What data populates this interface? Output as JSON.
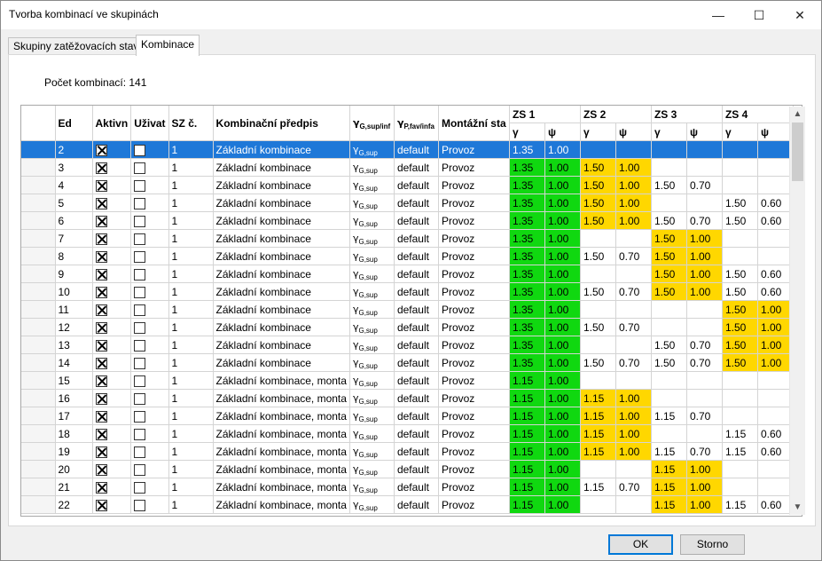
{
  "window": {
    "title": "Tvorba kombinací ve skupinách"
  },
  "titlebar_icons": {
    "minimize": "minimize-icon",
    "maximize": "maximize-icon",
    "close": "close-icon"
  },
  "tabs": [
    {
      "label": "Skupiny zatěžovacích stavů",
      "active": false
    },
    {
      "label": "Kombinace",
      "active": true
    }
  ],
  "count_label": "Počet kombinací: 141",
  "columns": {
    "ed": "Ed",
    "active": "Aktivn",
    "user": "Uživat",
    "sz": "SZ č.",
    "rule": "Kombinační předpis",
    "gamma_g_sym": "γ",
    "gamma_g_sub": "G,sup/inf",
    "gamma_p_sym": "γ",
    "gamma_p_sub": "P,fav/infa",
    "mont": "Montážní sta",
    "groups": [
      "ZS 1",
      "ZS 2",
      "ZS 3",
      "ZS 4"
    ],
    "gamma": "γ",
    "psi": "ψ"
  },
  "colors": {
    "green": "#10d810",
    "yellow": "#ffd700",
    "selected": "#1e78d8"
  },
  "rows": [
    {
      "ed": "2",
      "active": true,
      "user": false,
      "sz": "1",
      "rule": "Základní kombinace",
      "gsub": "G,sup",
      "p": "default",
      "mont": "Provoz",
      "v": [
        [
          "1.35",
          "1.00",
          "g"
        ],
        [
          "",
          "",
          ""
        ],
        [
          "",
          "",
          ""
        ],
        [
          "",
          "",
          ""
        ]
      ],
      "selected": true
    },
    {
      "ed": "3",
      "active": true,
      "user": false,
      "sz": "1",
      "rule": "Základní kombinace",
      "gsub": "G,sup",
      "p": "default",
      "mont": "Provoz",
      "v": [
        [
          "1.35",
          "1.00",
          "g"
        ],
        [
          "1.50",
          "1.00",
          "y"
        ],
        [
          "",
          "",
          ""
        ],
        [
          "",
          "",
          ""
        ]
      ]
    },
    {
      "ed": "4",
      "active": true,
      "user": false,
      "sz": "1",
      "rule": "Základní kombinace",
      "gsub": "G,sup",
      "p": "default",
      "mont": "Provoz",
      "v": [
        [
          "1.35",
          "1.00",
          "g"
        ],
        [
          "1.50",
          "1.00",
          "y"
        ],
        [
          "1.50",
          "0.70",
          ""
        ],
        [
          "",
          "",
          ""
        ]
      ]
    },
    {
      "ed": "5",
      "active": true,
      "user": false,
      "sz": "1",
      "rule": "Základní kombinace",
      "gsub": "G,sup",
      "p": "default",
      "mont": "Provoz",
      "v": [
        [
          "1.35",
          "1.00",
          "g"
        ],
        [
          "1.50",
          "1.00",
          "y"
        ],
        [
          "",
          "",
          ""
        ],
        [
          "1.50",
          "0.60",
          ""
        ]
      ]
    },
    {
      "ed": "6",
      "active": true,
      "user": false,
      "sz": "1",
      "rule": "Základní kombinace",
      "gsub": "G,sup",
      "p": "default",
      "mont": "Provoz",
      "v": [
        [
          "1.35",
          "1.00",
          "g"
        ],
        [
          "1.50",
          "1.00",
          "y"
        ],
        [
          "1.50",
          "0.70",
          ""
        ],
        [
          "1.50",
          "0.60",
          ""
        ]
      ]
    },
    {
      "ed": "7",
      "active": true,
      "user": false,
      "sz": "1",
      "rule": "Základní kombinace",
      "gsub": "G,sup",
      "p": "default",
      "mont": "Provoz",
      "v": [
        [
          "1.35",
          "1.00",
          "g"
        ],
        [
          "",
          "",
          ""
        ],
        [
          "1.50",
          "1.00",
          "y"
        ],
        [
          "",
          "",
          ""
        ]
      ]
    },
    {
      "ed": "8",
      "active": true,
      "user": false,
      "sz": "1",
      "rule": "Základní kombinace",
      "gsub": "G,sup",
      "p": "default",
      "mont": "Provoz",
      "v": [
        [
          "1.35",
          "1.00",
          "g"
        ],
        [
          "1.50",
          "0.70",
          ""
        ],
        [
          "1.50",
          "1.00",
          "y"
        ],
        [
          "",
          "",
          ""
        ]
      ]
    },
    {
      "ed": "9",
      "active": true,
      "user": false,
      "sz": "1",
      "rule": "Základní kombinace",
      "gsub": "G,sup",
      "p": "default",
      "mont": "Provoz",
      "v": [
        [
          "1.35",
          "1.00",
          "g"
        ],
        [
          "",
          "",
          ""
        ],
        [
          "1.50",
          "1.00",
          "y"
        ],
        [
          "1.50",
          "0.60",
          ""
        ]
      ]
    },
    {
      "ed": "10",
      "active": true,
      "user": false,
      "sz": "1",
      "rule": "Základní kombinace",
      "gsub": "G,sup",
      "p": "default",
      "mont": "Provoz",
      "v": [
        [
          "1.35",
          "1.00",
          "g"
        ],
        [
          "1.50",
          "0.70",
          ""
        ],
        [
          "1.50",
          "1.00",
          "y"
        ],
        [
          "1.50",
          "0.60",
          ""
        ]
      ]
    },
    {
      "ed": "11",
      "active": true,
      "user": false,
      "sz": "1",
      "rule": "Základní kombinace",
      "gsub": "G,sup",
      "p": "default",
      "mont": "Provoz",
      "v": [
        [
          "1.35",
          "1.00",
          "g"
        ],
        [
          "",
          "",
          ""
        ],
        [
          "",
          "",
          ""
        ],
        [
          "1.50",
          "1.00",
          "y"
        ]
      ]
    },
    {
      "ed": "12",
      "active": true,
      "user": false,
      "sz": "1",
      "rule": "Základní kombinace",
      "gsub": "G,sup",
      "p": "default",
      "mont": "Provoz",
      "v": [
        [
          "1.35",
          "1.00",
          "g"
        ],
        [
          "1.50",
          "0.70",
          ""
        ],
        [
          "",
          "",
          ""
        ],
        [
          "1.50",
          "1.00",
          "y"
        ]
      ]
    },
    {
      "ed": "13",
      "active": true,
      "user": false,
      "sz": "1",
      "rule": "Základní kombinace",
      "gsub": "G,sup",
      "p": "default",
      "mont": "Provoz",
      "v": [
        [
          "1.35",
          "1.00",
          "g"
        ],
        [
          "",
          "",
          ""
        ],
        [
          "1.50",
          "0.70",
          ""
        ],
        [
          "1.50",
          "1.00",
          "y"
        ]
      ]
    },
    {
      "ed": "14",
      "active": true,
      "user": false,
      "sz": "1",
      "rule": "Základní kombinace",
      "gsub": "G,sup",
      "p": "default",
      "mont": "Provoz",
      "v": [
        [
          "1.35",
          "1.00",
          "g"
        ],
        [
          "1.50",
          "0.70",
          ""
        ],
        [
          "1.50",
          "0.70",
          ""
        ],
        [
          "1.50",
          "1.00",
          "y"
        ]
      ]
    },
    {
      "ed": "15",
      "active": true,
      "user": false,
      "sz": "1",
      "rule": "Základní kombinace, monta",
      "gsub": "G,sup",
      "p": "default",
      "mont": "Provoz",
      "v": [
        [
          "1.15",
          "1.00",
          "g"
        ],
        [
          "",
          "",
          ""
        ],
        [
          "",
          "",
          ""
        ],
        [
          "",
          "",
          ""
        ]
      ]
    },
    {
      "ed": "16",
      "active": true,
      "user": false,
      "sz": "1",
      "rule": "Základní kombinace, monta",
      "gsub": "G,sup",
      "p": "default",
      "mont": "Provoz",
      "v": [
        [
          "1.15",
          "1.00",
          "g"
        ],
        [
          "1.15",
          "1.00",
          "y"
        ],
        [
          "",
          "",
          ""
        ],
        [
          "",
          "",
          ""
        ]
      ]
    },
    {
      "ed": "17",
      "active": true,
      "user": false,
      "sz": "1",
      "rule": "Základní kombinace, monta",
      "gsub": "G,sup",
      "p": "default",
      "mont": "Provoz",
      "v": [
        [
          "1.15",
          "1.00",
          "g"
        ],
        [
          "1.15",
          "1.00",
          "y"
        ],
        [
          "1.15",
          "0.70",
          ""
        ],
        [
          "",
          "",
          ""
        ]
      ]
    },
    {
      "ed": "18",
      "active": true,
      "user": false,
      "sz": "1",
      "rule": "Základní kombinace, monta",
      "gsub": "G,sup",
      "p": "default",
      "mont": "Provoz",
      "v": [
        [
          "1.15",
          "1.00",
          "g"
        ],
        [
          "1.15",
          "1.00",
          "y"
        ],
        [
          "",
          "",
          ""
        ],
        [
          "1.15",
          "0.60",
          ""
        ]
      ]
    },
    {
      "ed": "19",
      "active": true,
      "user": false,
      "sz": "1",
      "rule": "Základní kombinace, monta",
      "gsub": "G,sup",
      "p": "default",
      "mont": "Provoz",
      "v": [
        [
          "1.15",
          "1.00",
          "g"
        ],
        [
          "1.15",
          "1.00",
          "y"
        ],
        [
          "1.15",
          "0.70",
          ""
        ],
        [
          "1.15",
          "0.60",
          ""
        ]
      ]
    },
    {
      "ed": "20",
      "active": true,
      "user": false,
      "sz": "1",
      "rule": "Základní kombinace, monta",
      "gsub": "G,sup",
      "p": "default",
      "mont": "Provoz",
      "v": [
        [
          "1.15",
          "1.00",
          "g"
        ],
        [
          "",
          "",
          ""
        ],
        [
          "1.15",
          "1.00",
          "y"
        ],
        [
          "",
          "",
          ""
        ]
      ]
    },
    {
      "ed": "21",
      "active": true,
      "user": false,
      "sz": "1",
      "rule": "Základní kombinace, monta",
      "gsub": "G,sup",
      "p": "default",
      "mont": "Provoz",
      "v": [
        [
          "1.15",
          "1.00",
          "g"
        ],
        [
          "1.15",
          "0.70",
          ""
        ],
        [
          "1.15",
          "1.00",
          "y"
        ],
        [
          "",
          "",
          ""
        ]
      ]
    },
    {
      "ed": "22",
      "active": true,
      "user": false,
      "sz": "1",
      "rule": "Základní kombinace, monta",
      "gsub": "G,sup",
      "p": "default",
      "mont": "Provoz",
      "v": [
        [
          "1.15",
          "1.00",
          "g"
        ],
        [
          "",
          "",
          ""
        ],
        [
          "1.15",
          "1.00",
          "y"
        ],
        [
          "1.15",
          "0.60",
          ""
        ]
      ]
    }
  ],
  "buttons": {
    "ok": "OK",
    "cancel": "Storno"
  },
  "scrollbar_icons": {
    "up": "chevron-up-icon",
    "down": "chevron-down-icon"
  }
}
